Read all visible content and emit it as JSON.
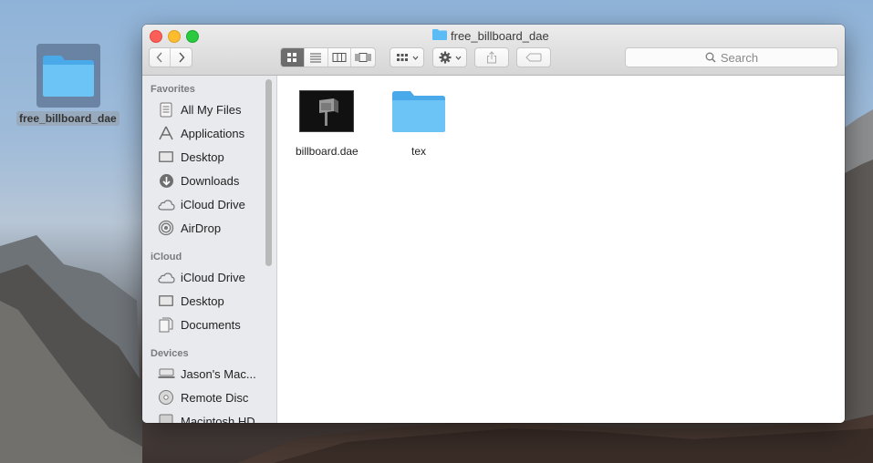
{
  "desktop": {
    "folder_label": "free_billboard_dae"
  },
  "window": {
    "title": "free_billboard_dae",
    "search_placeholder": "Search"
  },
  "sidebar": {
    "sections": [
      {
        "title": "Favorites",
        "items": [
          {
            "label": "All My Files",
            "icon": "all-files-icon"
          },
          {
            "label": "Applications",
            "icon": "applications-icon"
          },
          {
            "label": "Desktop",
            "icon": "desktop-icon"
          },
          {
            "label": "Downloads",
            "icon": "downloads-icon"
          },
          {
            "label": "iCloud Drive",
            "icon": "cloud-icon"
          },
          {
            "label": "AirDrop",
            "icon": "airdrop-icon"
          }
        ]
      },
      {
        "title": "iCloud",
        "items": [
          {
            "label": "iCloud Drive",
            "icon": "cloud-icon"
          },
          {
            "label": "Desktop",
            "icon": "desktop-icon"
          },
          {
            "label": "Documents",
            "icon": "documents-icon"
          }
        ]
      },
      {
        "title": "Devices",
        "items": [
          {
            "label": "Jason's Mac...",
            "icon": "computer-icon"
          },
          {
            "label": "Remote Disc",
            "icon": "disc-icon"
          },
          {
            "label": "Macintosh HD",
            "icon": "harddisk-icon"
          }
        ]
      }
    ]
  },
  "files": [
    {
      "name": "billboard.dae",
      "icon": "3d-model-thumbnail"
    },
    {
      "name": "tex",
      "icon": "folder-icon"
    }
  ],
  "colors": {
    "folder_blue": "#5bbcf5",
    "accent": "#1a82fb"
  }
}
